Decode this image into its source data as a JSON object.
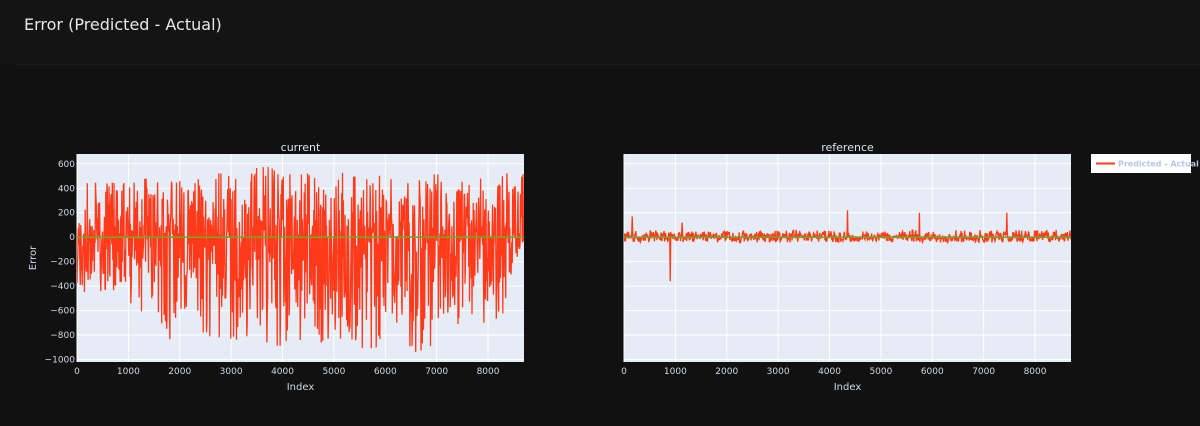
{
  "page": {
    "title": "Error (Predicted - Actual)"
  },
  "colors": {
    "background": "#111111",
    "plot_bg": "#e5ecf6",
    "grid": "#ffffff",
    "series": "#ff3a1a",
    "zero_line": "#7f9f1f",
    "legend_bg": "#ffffff"
  },
  "chart_data": [
    {
      "type": "line",
      "title": "current",
      "xlabel": "Index",
      "ylabel": "Error",
      "xlim": [
        0,
        8700
      ],
      "ylim": [
        -1020,
        680
      ],
      "xticks": [
        0,
        1000,
        2000,
        3000,
        4000,
        5000,
        6000,
        7000,
        8000
      ],
      "yticks": [
        -1000,
        -800,
        -600,
        -400,
        -200,
        0,
        200,
        400,
        600
      ],
      "ytick_labels": [
        "−1000",
        "−800",
        "−600",
        "−400",
        "−200",
        "0",
        "200",
        "400",
        "600"
      ],
      "grid": true,
      "legend": "top-right",
      "envelope": {
        "x": [
          0,
          200,
          500,
          800,
          1000,
          1300,
          1600,
          2000,
          2500,
          3000,
          3500,
          4000,
          4500,
          5000,
          5500,
          6000,
          6500,
          7000,
          7500,
          8000,
          8300,
          8500,
          8700
        ],
        "upper": [
          280,
          500,
          430,
          490,
          520,
          560,
          440,
          480,
          530,
          560,
          590,
          560,
          540,
          520,
          540,
          560,
          500,
          520,
          510,
          480,
          540,
          560,
          560
        ],
        "lower": [
          -420,
          -480,
          -500,
          -420,
          -560,
          -620,
          -760,
          -940,
          -820,
          -870,
          -880,
          -900,
          -860,
          -880,
          -920,
          -930,
          -950,
          -930,
          -800,
          -700,
          -640,
          -200,
          -120
        ]
      },
      "series": [
        {
          "name": "Predicted - Actual",
          "color": "#ff3a1a"
        }
      ]
    },
    {
      "type": "line",
      "title": "reference",
      "xlabel": "Index",
      "xlim": [
        0,
        8700
      ],
      "ylim": [
        -1020,
        680
      ],
      "xticks": [
        0,
        1000,
        2000,
        3000,
        4000,
        5000,
        6000,
        7000,
        8000
      ],
      "grid": true,
      "envelope": {
        "x": [
          0,
          500,
          1000,
          2000,
          3000,
          4000,
          5000,
          6000,
          7000,
          8000,
          8700
        ],
        "upper": [
          50,
          60,
          50,
          50,
          60,
          60,
          55,
          60,
          60,
          60,
          60
        ],
        "lower": [
          -40,
          -45,
          -40,
          -40,
          -45,
          -45,
          -40,
          -45,
          -45,
          -40,
          -45
        ]
      },
      "spikes": [
        {
          "x": 900,
          "y": -360
        },
        {
          "x": 4350,
          "y": 220
        },
        {
          "x": 5750,
          "y": 200
        },
        {
          "x": 7450,
          "y": 200
        },
        {
          "x": 160,
          "y": 170
        },
        {
          "x": 1130,
          "y": 120
        }
      ],
      "series": [
        {
          "name": "Predicted - Actual",
          "color": "#ff3a1a"
        }
      ]
    }
  ]
}
